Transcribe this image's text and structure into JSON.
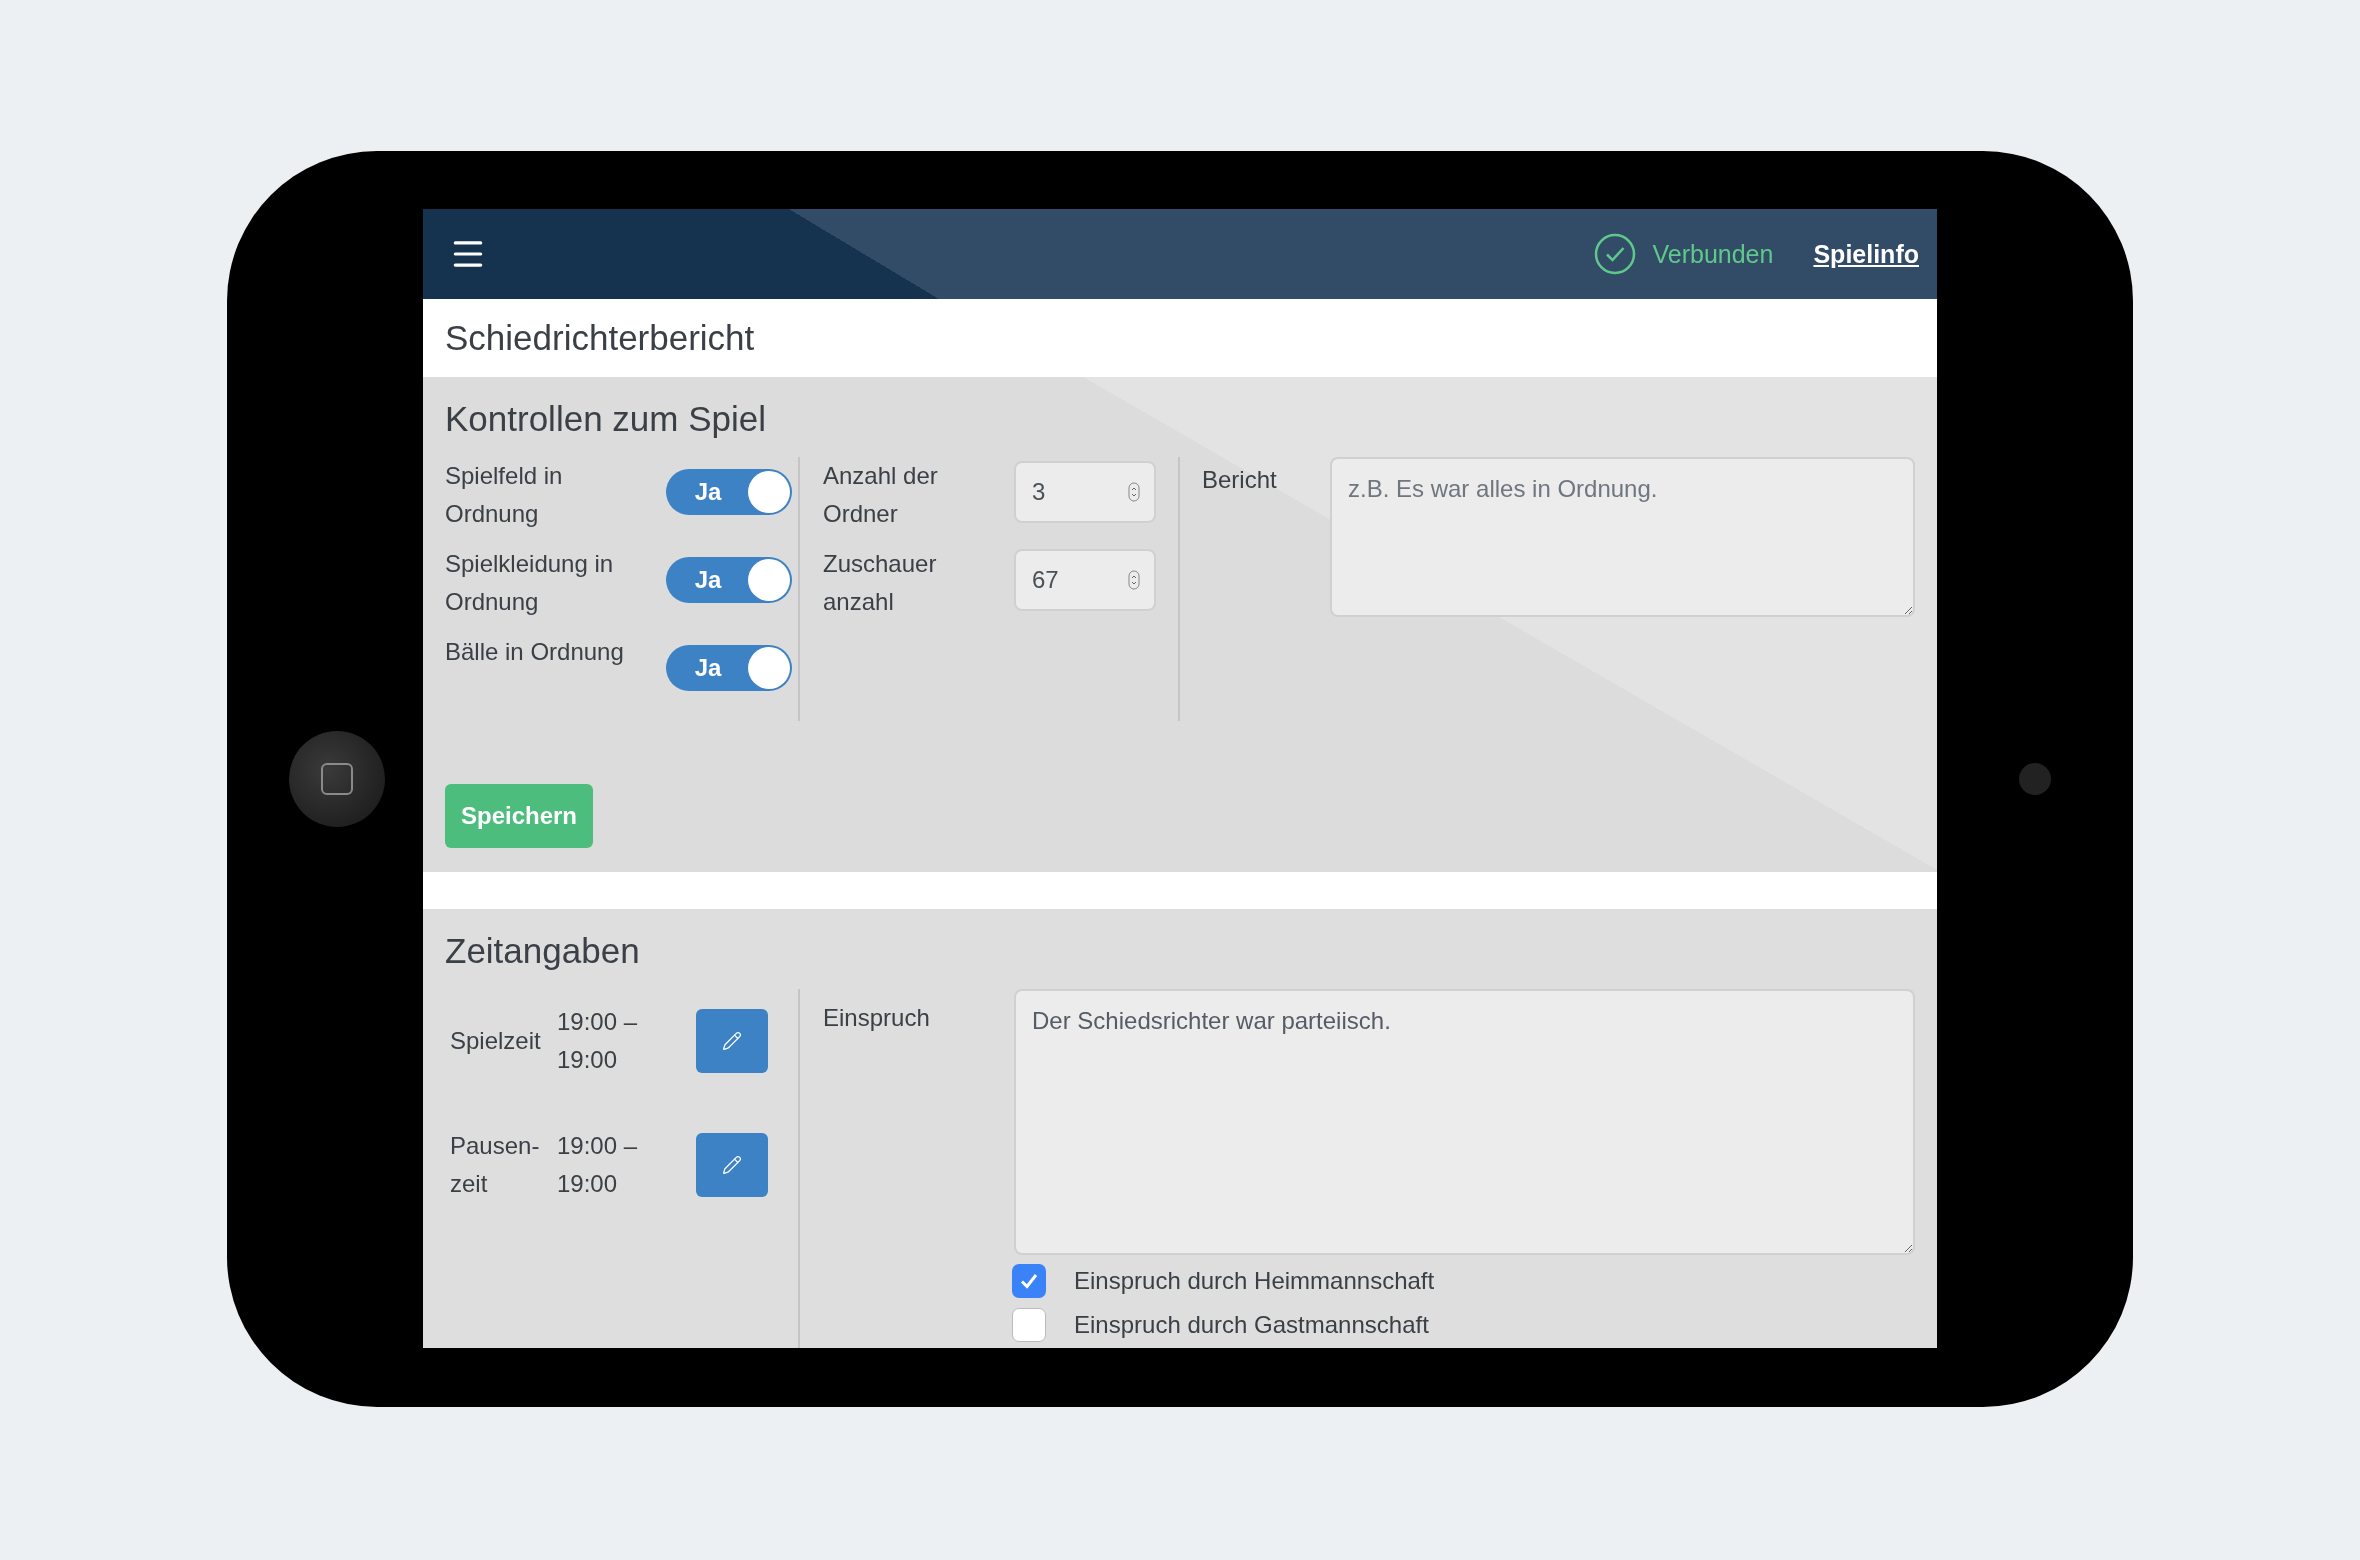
{
  "header": {
    "status": "Verbunden",
    "link": "Spielinfo"
  },
  "page_title": "Schiedrichterbericht",
  "controls": {
    "title": "Kontrollen zum Spiel",
    "toggles": [
      {
        "label": "Spielfeld in Ordnung",
        "switch_label": "Ja",
        "on": true
      },
      {
        "label": "Spielkleidung in Ordnung",
        "switch_label": "Ja",
        "on": true
      },
      {
        "label": "Bälle in Ordnung",
        "switch_label": "Ja",
        "on": true
      }
    ],
    "counts": [
      {
        "label": "Anzahl der Ordner",
        "value": "3"
      },
      {
        "label": "Zuschauer anzahl",
        "value": "67"
      }
    ],
    "report": {
      "label": "Bericht",
      "placeholder": "z.B. Es war alles in Ordnung."
    },
    "save_button": "Speichern"
  },
  "times": {
    "title": "Zeitangaben",
    "rows": [
      {
        "label": "Spielzeit",
        "value": "19:00 – 19:00"
      },
      {
        "label": "Pausen-zeit",
        "value": "19:00 – 19:00"
      }
    ],
    "objection": {
      "label": "Einspruch",
      "value": "Der Schiedsrichter war parteiisch."
    },
    "checkboxes": [
      {
        "label": "Einspruch durch Heimmannschaft",
        "checked": true
      },
      {
        "label": "Einspruch durch Gastmannschaft",
        "checked": false
      }
    ]
  }
}
